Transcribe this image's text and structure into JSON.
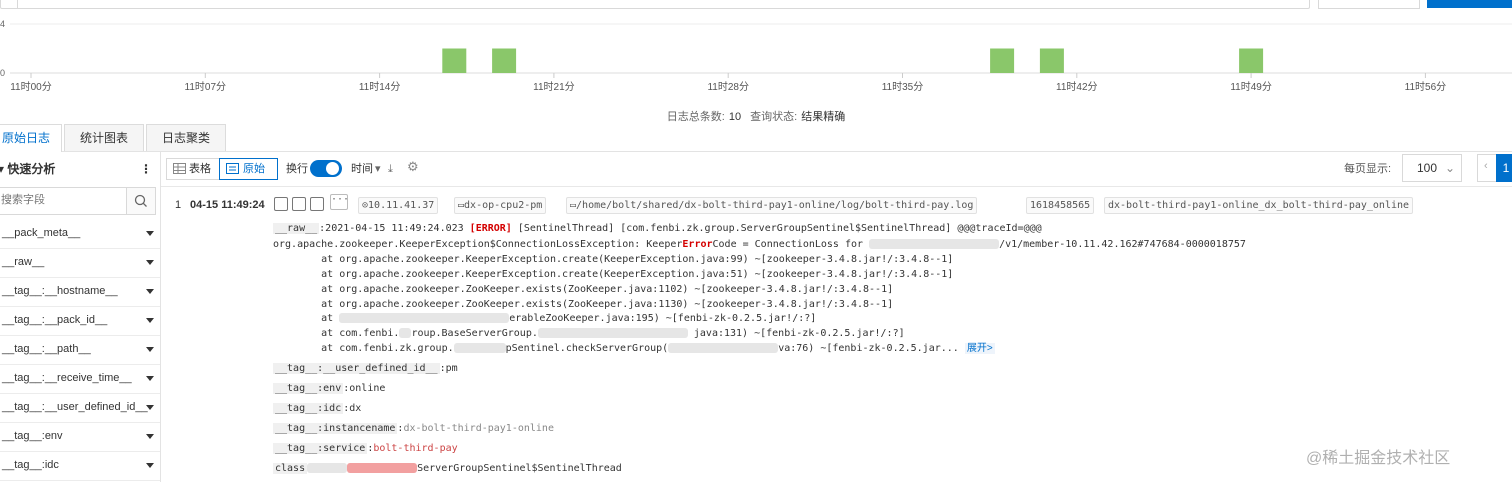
{
  "chart_data": {
    "type": "bar",
    "y_ticks": [
      "4",
      "0"
    ],
    "x_tick_labels": [
      "11时00分",
      "11时07分",
      "11时14分",
      "11时21分",
      "11时28分",
      "11时35分",
      "11时42分",
      "11时49分",
      "11时56分"
    ],
    "x_minutes": [
      0,
      7,
      14,
      21,
      28,
      35,
      42,
      49,
      56
    ],
    "xlim_minutes": [
      0,
      60
    ],
    "ylim": [
      0,
      4
    ],
    "bars": [
      {
        "minute": 17,
        "value": 2
      },
      {
        "minute": 19,
        "value": 2
      },
      {
        "minute": 39,
        "value": 2
      },
      {
        "minute": 41,
        "value": 2
      },
      {
        "minute": 49,
        "value": 2
      }
    ],
    "bar_color": "#8ac76a",
    "grid": true
  },
  "summary": {
    "total_label": "日志总条数:",
    "total_value": "10",
    "status_label": "查询状态:",
    "status_value": "结果精确"
  },
  "tabs": [
    "原始日志",
    "统计图表",
    "日志聚类"
  ],
  "sidebar": {
    "title": "快速分析",
    "search_placeholder": "搜索字段",
    "fields": [
      "__pack_meta__",
      "__raw__",
      "__tag__:__hostname__",
      "__tag__:__pack_id__",
      "__tag__:__path__",
      "__tag__:__receive_time__",
      "__tag__:__user_defined_id__",
      "__tag__:env",
      "__tag__:idc"
    ]
  },
  "toolbar": {
    "table_label": "表格",
    "raw_label": "原始",
    "wrap_label": "换行",
    "time_label": "时间",
    "page_size_label": "每页显示:",
    "page_size": "100",
    "current_page": "1"
  },
  "log": {
    "index": "1",
    "time": "04-15 11:49:24",
    "chips": [
      "10.11.41.37",
      "dx-op-cpu2-pm",
      "/home/bolt/shared/dx-bolt-third-pay1-online/log/bolt-third-pay.log",
      "1618458565",
      "dx-bolt-third-pay1-online_dx_bolt-third-pay_online"
    ],
    "raw_key": "__raw__",
    "raw_first": ":2021-04-15 11:49:24.023 ",
    "raw_error": "[ERROR]",
    "raw_rest": " [SentinelThread] [com.fenbi.zk.group.ServerGroupSentinel$SentinelThread] @@@traceId=@@@",
    "exc_prefix": "org.apache.zookeeper.KeeperException$ConnectionLossException: Keeper",
    "exc_error": "Error",
    "exc_mid": "Code = ConnectionLoss for ",
    "exc_tail": "/v1/member-10.11.42.162#747684-0000018757",
    "stack": [
      "        at org.apache.zookeeper.KeeperException.create(KeeperException.java:99) ~[zookeeper-3.4.8.jar!/:3.4.8--1]",
      "        at org.apache.zookeeper.KeeperException.create(KeeperException.java:51) ~[zookeeper-3.4.8.jar!/:3.4.8--1]",
      "        at org.apache.zookeeper.ZooKeeper.exists(ZooKeeper.java:1102) ~[zookeeper-3.4.8.jar!/:3.4.8--1]",
      "        at org.apache.zookeeper.ZooKeeper.exists(ZooKeeper.java:1130) ~[zookeeper-3.4.8.jar!/:3.4.8--1]"
    ],
    "stack5_pre": "        at ",
    "stack5_tail": "erableZooKeeper.java:195) ~[fenbi-zk-0.2.5.jar!/:?]",
    "stack6_pre": "        at com.fenbi.",
    "stack6_mid": "roup.BaseServerGroup.",
    "stack6_tail": " java:131) ~[fenbi-zk-0.2.5.jar!/:?]",
    "stack7_pre": "        at com.fenbi.zk.group.",
    "stack7_mid": "pSentinel.checkServerGroup(",
    "stack7_tail": "va:76) ~[fenbi-zk-0.2.5.jar...",
    "expand_label": "展开>",
    "tags": [
      {
        "key": "__tag__:__user_defined_id__",
        "sep": ":",
        "value": "pm"
      },
      {
        "key": "__tag__:env",
        "sep": ":",
        "value": "online"
      },
      {
        "key": "__tag__:idc",
        "sep": ":",
        "value": "dx"
      },
      {
        "key": "__tag__:instancename",
        "sep": ":",
        "value": "dx-bolt-third-pay1-online"
      },
      {
        "key": "__tag__:service",
        "sep": ":",
        "value": "bolt-third-pay"
      }
    ],
    "class_key": "class",
    "class_value": "ServerGroupSentinel$SentinelThread"
  },
  "watermark": "@稀土掘金技术社区"
}
